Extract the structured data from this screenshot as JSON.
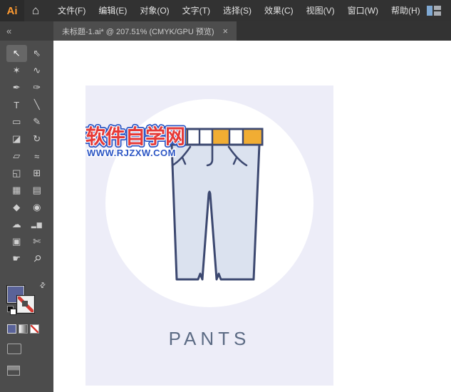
{
  "app": {
    "logo": "Ai",
    "menu": [
      "文件(F)",
      "编辑(E)",
      "对象(O)",
      "文字(T)",
      "选择(S)",
      "效果(C)",
      "视图(V)",
      "窗口(W)",
      "帮助(H)"
    ]
  },
  "tab": {
    "title": "未标题-1.ai* @ 207.51% (CMYK/GPU 预览)",
    "close_label": "×"
  },
  "icons": {
    "home": "⌂",
    "collapse": "«",
    "swap": "⇄"
  },
  "toolbar": {
    "tools": [
      {
        "id": "selection-tool",
        "glyph": "↖",
        "active": true
      },
      {
        "id": "direct-selection-tool",
        "glyph": "⇖"
      },
      {
        "id": "magic-wand-tool",
        "glyph": "✶"
      },
      {
        "id": "lasso-tool",
        "glyph": "∿"
      },
      {
        "id": "pen-tool",
        "glyph": "✒"
      },
      {
        "id": "paintbrush-tool",
        "glyph": "✑"
      },
      {
        "id": "type-tool",
        "glyph": "T"
      },
      {
        "id": "line-segment-tool",
        "glyph": "╲"
      },
      {
        "id": "rectangle-tool",
        "glyph": "▭"
      },
      {
        "id": "pencil-tool",
        "glyph": "✎"
      },
      {
        "id": "eraser-tool",
        "glyph": "◪"
      },
      {
        "id": "rotate-tool",
        "glyph": "↻"
      },
      {
        "id": "scale-tool",
        "glyph": "▱"
      },
      {
        "id": "width-tool",
        "glyph": "≈"
      },
      {
        "id": "shape-builder-tool",
        "glyph": "◱"
      },
      {
        "id": "perspective-grid-tool",
        "glyph": "⊞"
      },
      {
        "id": "mesh-tool",
        "glyph": "▦"
      },
      {
        "id": "gradient-tool",
        "glyph": "▤"
      },
      {
        "id": "eyedropper-tool",
        "glyph": "◆"
      },
      {
        "id": "blend-tool",
        "glyph": "◉"
      },
      {
        "id": "symbol-sprayer-tool",
        "glyph": "☁"
      },
      {
        "id": "column-graph-tool",
        "glyph": "▂▆"
      },
      {
        "id": "artboard-tool",
        "glyph": "▣"
      },
      {
        "id": "slice-tool",
        "glyph": "✄"
      },
      {
        "id": "hand-tool",
        "glyph": "☛"
      },
      {
        "id": "zoom-tool",
        "glyph": "⚲"
      }
    ]
  },
  "artboard": {
    "watermark_line1": "软件自学网",
    "watermark_line2": "WWW.RJZXW.COM",
    "caption": "PANTS"
  },
  "colors": {
    "logo_orange": "#ff9b31",
    "artboard_bg": "#ededf8",
    "circle_bg": "#ffffff",
    "pants_fill": "#dbe2ef",
    "pants_outline": "#3c4870",
    "belt_orange": "#f1ad33",
    "watermark_red": "#e53a38",
    "watermark_blue": "#2b55c4",
    "caption_color": "#5c6b84",
    "fill_swatch": "#5a6399"
  }
}
